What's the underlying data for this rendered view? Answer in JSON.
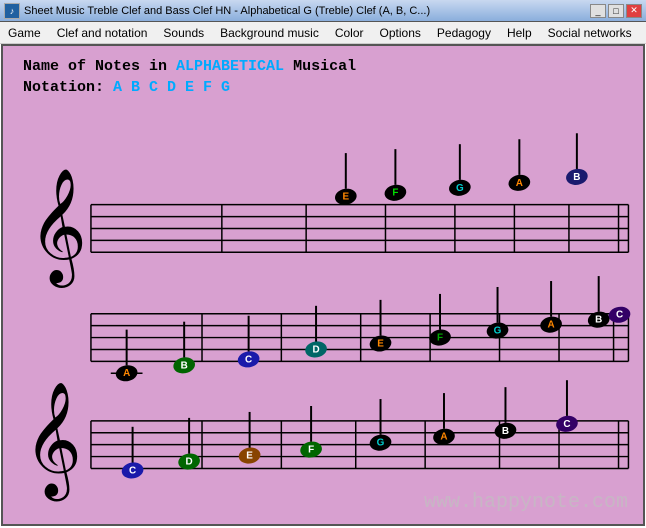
{
  "titlebar": {
    "text": "Sheet Music Treble Clef and Bass Clef HN - Alphabetical G (Treble) Clef (A, B, C...)",
    "icon": "♪"
  },
  "menubar": {
    "items": [
      "Game",
      "Clef and notation",
      "Sounds",
      "Background music",
      "Color",
      "Options",
      "Pedagogy",
      "Help",
      "Social networks"
    ]
  },
  "main": {
    "title_line1_normal": "Name of Notes in ",
    "title_line1_alpha": "ALPHABETICAL",
    "title_line1_musical": " Musical",
    "title_line2": "Notation: ",
    "title_note_letters": "A B C D E F G"
  },
  "website": "www.happynote.com",
  "titlebar_buttons": {
    "minimize": "_",
    "maximize": "□",
    "close": "✕"
  }
}
